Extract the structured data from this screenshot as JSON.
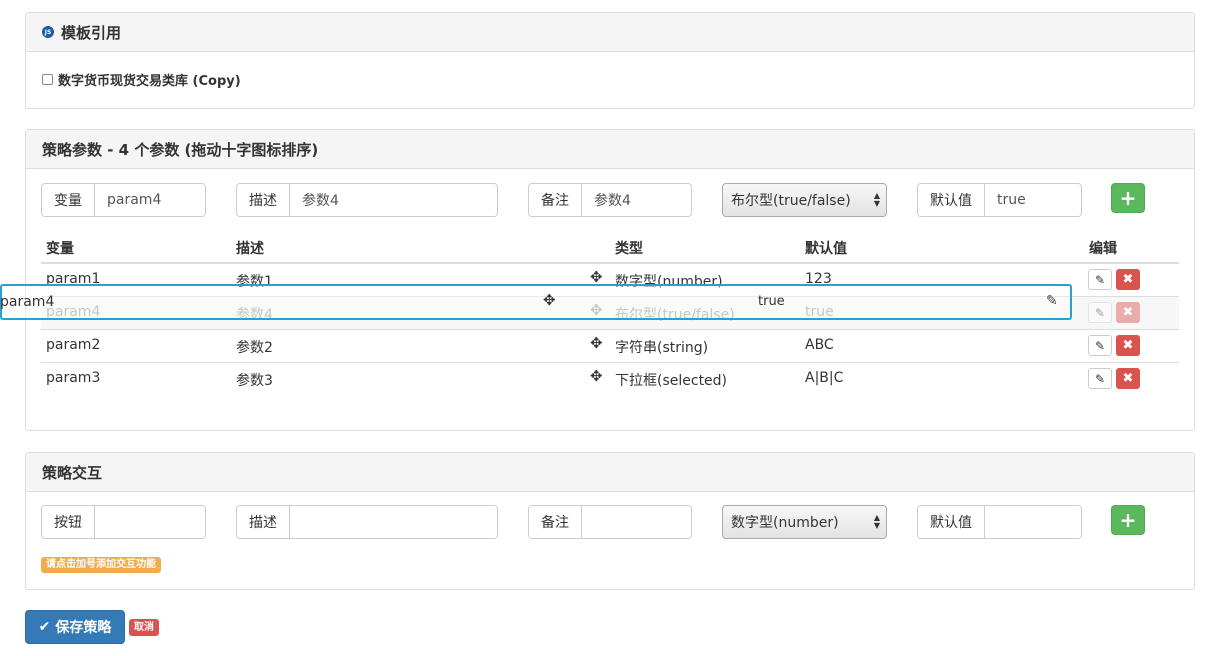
{
  "template_panel": {
    "icon": "js-icon",
    "icon_text": "JS",
    "title": "模板引用",
    "checkbox_label": "数字货币现货交易类库 (Copy)",
    "checked": false
  },
  "params_panel": {
    "title": "策略参数 - 4 个参数 (拖动十字图标排序)",
    "form": {
      "var_label": "变量",
      "var_value": "param4",
      "desc_label": "描述",
      "desc_value": "参数4",
      "note_label": "备注",
      "note_value": "参数4",
      "type_selected": "布尔型(true/false)",
      "default_label": "默认值",
      "default_value": "true",
      "add_label": "+"
    },
    "table": {
      "headers": [
        "变量",
        "描述",
        "类型",
        "默认值",
        "编辑"
      ],
      "rows": [
        {
          "var": "param1",
          "desc": "参数1",
          "type": "数字型(number)",
          "default": "123"
        },
        {
          "var": "param4",
          "desc": "参数4",
          "type": "布尔型(true/false)",
          "default": "true"
        },
        {
          "var": "param2",
          "desc": "参数2",
          "type": "字符串(string)",
          "default": "ABC"
        },
        {
          "var": "param3",
          "desc": "参数3",
          "type": "下拉框(selected)",
          "default": "A|B|C"
        }
      ],
      "dragging_row": {
        "var": "param4",
        "default": "true"
      }
    }
  },
  "interaction_panel": {
    "title": "策略交互",
    "form": {
      "button_label": "按钮",
      "button_value": "",
      "desc_label": "描述",
      "desc_value": "",
      "note_label": "备注",
      "note_value": "",
      "type_selected": "数字型(number)",
      "default_label": "默认值",
      "default_value": "",
      "add_label": "+"
    },
    "hint": "请点击加号添加交互功能"
  },
  "actions": {
    "save_label": "保存策略",
    "cancel_label": "取消"
  },
  "colors": {
    "primary": "#337ab7",
    "success": "#5cb85c",
    "danger": "#d9534f",
    "warning": "#f0ad4e",
    "drag_border": "#2aa0d2"
  }
}
